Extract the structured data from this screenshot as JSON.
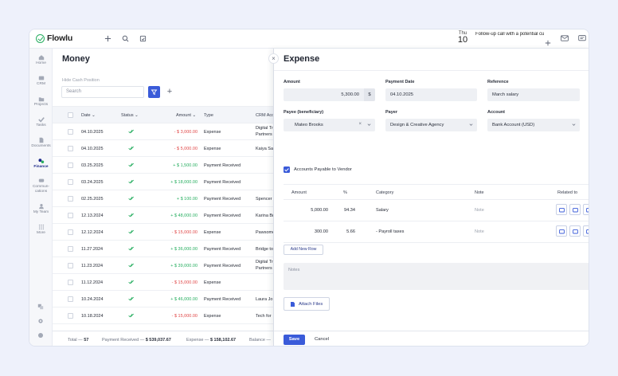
{
  "app": {
    "logo_text": "Flowlu",
    "date_dow": "Thu",
    "date_day": "10",
    "reminder": "Follow-up call with a potential cu"
  },
  "sidebar": {
    "items": [
      {
        "label": "Home",
        "icon": "home-icon"
      },
      {
        "label": "CRM",
        "icon": "crm-icon"
      },
      {
        "label": "Projects",
        "icon": "projects-icon"
      },
      {
        "label": "Tasks",
        "icon": "tasks-icon"
      },
      {
        "label": "Documents",
        "icon": "documents-icon"
      },
      {
        "label": "Finance",
        "icon": "finance-icon"
      },
      {
        "label": "Commun-",
        "label2": "cations",
        "icon": "communications-icon"
      },
      {
        "label": "My Team",
        "icon": "team-icon"
      },
      {
        "label": "More",
        "icon": "more-grid-icon"
      }
    ]
  },
  "money": {
    "title": "Money",
    "hide_cash": "Hide Cash Position",
    "search_placeholder": "Search",
    "columns": {
      "date": "Date",
      "status": "Status",
      "amount": "Amount",
      "type": "Type",
      "crm": "CRM Acc"
    },
    "rows": [
      {
        "date": "04.10.2025",
        "amount": "- $ 3,000.00",
        "neg": true,
        "type": "Expense",
        "crm": [
          "Digital Tr",
          "Partners"
        ]
      },
      {
        "date": "04.10.2025",
        "amount": "- $ 5,000.00",
        "neg": true,
        "type": "Expense",
        "crm": [
          "Kaiya Sa"
        ]
      },
      {
        "date": "03.25.2025",
        "amount": "+ $ 1,500.00",
        "neg": false,
        "type": "Payment Received",
        "crm": []
      },
      {
        "date": "03.24.2025",
        "amount": "+ $ 18,000.00",
        "neg": false,
        "type": "Payment Received",
        "crm": []
      },
      {
        "date": "02.25.2025",
        "amount": "+ $ 100.00",
        "neg": false,
        "type": "Payment Received",
        "crm": [
          "Spencer"
        ]
      },
      {
        "date": "12.13.2024",
        "amount": "+ $ 48,000.00",
        "neg": false,
        "type": "Payment Received",
        "crm": [
          "Karina Br"
        ]
      },
      {
        "date": "12.12.2024",
        "amount": "- $ 15,000.00",
        "neg": true,
        "type": "Expense",
        "crm": [
          "Pawsome"
        ]
      },
      {
        "date": "11.27.2024",
        "amount": "+ $ 36,000.00",
        "neg": false,
        "type": "Payment Received",
        "crm": [
          "Bridge to"
        ]
      },
      {
        "date": "11.23.2024",
        "amount": "+ $ 39,000.00",
        "neg": false,
        "type": "Payment Received",
        "crm": [
          "Digital Tr",
          "Partners"
        ]
      },
      {
        "date": "11.12.2024",
        "amount": "- $ 15,000.00",
        "neg": true,
        "type": "Expense",
        "crm": []
      },
      {
        "date": "10.24.2024",
        "amount": "+ $ 46,000.00",
        "neg": false,
        "type": "Payment Received",
        "crm": [
          "Laura Jo"
        ]
      },
      {
        "date": "10.18.2024",
        "amount": "- $ 15,000.00",
        "neg": true,
        "type": "Expense",
        "crm": [
          "Tech for"
        ]
      }
    ],
    "footer": {
      "total_label": "Total —",
      "total_value": "57",
      "received_label": "Payment Received — ",
      "received_value": "$ 539,037.67",
      "expense_label": "Expense — ",
      "expense_value": "$ 158,102.67",
      "balance_label": "Balance —"
    }
  },
  "expense": {
    "title": "Expense",
    "amount_label": "Amount",
    "amount_value": "5,300.00",
    "currency": "$",
    "payment_date_label": "Payment Date",
    "payment_date_value": "04.10.2025",
    "reference_label": "Reference",
    "reference_value": "March salary",
    "payee_label": "Payee (beneficiary)",
    "payee_value": "Mateo Brooks",
    "payer_label": "Payer",
    "payer_value": "Design & Creative Agency",
    "account_label": "Account",
    "account_value": "Bank Account (USD)",
    "ap_label": "Accounts Payable to Vendor",
    "split_columns": {
      "amount": "Amount",
      "pct": "%",
      "category": "Category",
      "note": "Note",
      "related": "Related to"
    },
    "split_rows": [
      {
        "amount": "5,000.00",
        "pct": "94.34",
        "category": "Salary",
        "note": "Note"
      },
      {
        "amount": "300.00",
        "pct": "5.66",
        "category": "- Payroll taxes",
        "note": "Note"
      }
    ],
    "add_row_label": "Add New Row",
    "notes_placeholder": "Notes",
    "attach_label": "Attach Files",
    "save_label": "Save",
    "cancel_label": "Cancel"
  },
  "colors": {
    "accent": "#3a5bd9",
    "positive": "#27ae60",
    "negative": "#e04848"
  }
}
